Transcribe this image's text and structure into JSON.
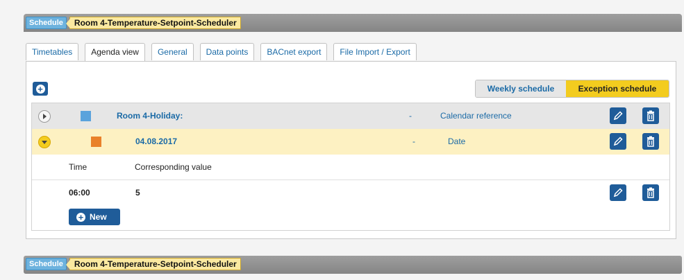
{
  "breadcrumb": {
    "section": "Schedule",
    "object": "Room 4-Temperature-Setpoint-Scheduler"
  },
  "tabs": [
    "Timetables",
    "Agenda view",
    "General",
    "Data points",
    "BACnet export",
    "File Import / Export"
  ],
  "active_tab": "Agenda view",
  "schedule_toggle": {
    "weekly": "Weekly schedule",
    "exception": "Exception schedule",
    "selected": "Exception schedule"
  },
  "colors": {
    "accent": "#1f5c99",
    "highlight": "#f3cc1f",
    "holiday_swatch": "#5aa3dc",
    "date_swatch": "#e9812a"
  },
  "entries": [
    {
      "name": "Room 4-Holiday:",
      "dash": "-",
      "type": "Calendar reference",
      "expanded": false
    },
    {
      "name": "04.08.2017",
      "dash": "-",
      "type": "Date",
      "expanded": true
    }
  ],
  "value_table": {
    "headers": {
      "time": "Time",
      "value": "Corresponding value"
    },
    "rows": [
      {
        "time": "06:00",
        "value": "5"
      }
    ]
  },
  "new_label": "New",
  "icons": {
    "add": "plus-circle-icon",
    "edit": "pencil-icon",
    "delete": "trash-icon",
    "expand": "expand-arrow-icon"
  }
}
